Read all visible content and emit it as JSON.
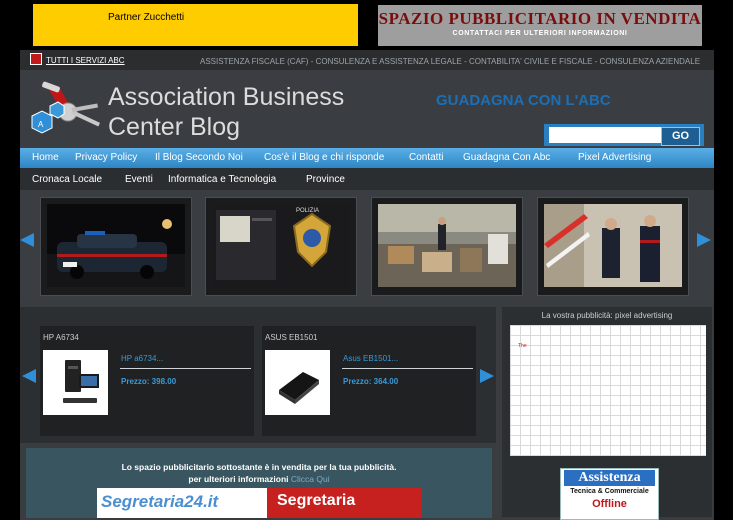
{
  "banners": {
    "left_text": "Partner Zucchetti",
    "right_title": "SPAZIO PUBBLICITARIO IN VENDITA",
    "right_sub": "CONTATTACI PER ULTERIORI INFORMAZIONI"
  },
  "servicebar": {
    "link": "TUTTI I SERVIZI ABC",
    "ticker": "ASSISTENZA FISCALE (CAF) - CONSULENZA E ASSISTENZA LEGALE - CONTABILITA' CIVILE E FISCALE - CONSULENZA AZIENDALE"
  },
  "header": {
    "title_line1": "Association Business",
    "title_line2": "Center Blog",
    "promo": "GUADAGNA CON L'ABC",
    "search_placeholder": "",
    "search_button": "GO"
  },
  "nav_primary": [
    "Home",
    "Privacy Policy",
    "Il Blog Secondo Noi",
    "Cos'è il Blog e chi risponde",
    "Contatti",
    "Guadagna Con Abc",
    "Pixel Advertising"
  ],
  "nav_secondary": [
    "Cronaca Locale",
    "Eventi",
    "Informatica e Tecnologia",
    "Province"
  ],
  "products": [
    {
      "name": "HP A6734",
      "link": "HP a6734...",
      "price": "Prezzo: 398.00"
    },
    {
      "name": "ASUS EB1501",
      "link": "Asus EB1501...",
      "price": "Prezzo: 364.00"
    }
  ],
  "sidebar": {
    "pixel_title": "La vostra pubblicità: pixel advertising",
    "pixel_ad_label": "The",
    "assist_title": "Assistenza",
    "assist_sub": "Tecnica & Commerciale",
    "assist_tag": "Offline"
  },
  "ad": {
    "line1": "Lo spazio pubblicitario sottostante è in vendita per la tua pubblicità.",
    "line2": "per ulteriori informazioni",
    "click": "Clicca Qui",
    "banner_left": "Segretaria24.it",
    "banner_right": "Segretaria"
  },
  "colors": {
    "accent": "#2f8fd8",
    "nav": "#3a96d4"
  }
}
